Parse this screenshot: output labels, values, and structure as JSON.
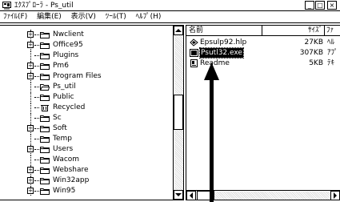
{
  "window": {
    "title": "ｴｸｽﾌﾟﾛｰﾗ - Ps_util",
    "minimize_label": "_",
    "maximize_label": "□",
    "close_label": "×"
  },
  "menubar": {
    "items": [
      {
        "label": "ﾌｧｲﾙ(F)"
      },
      {
        "label": "編集(E)"
      },
      {
        "label": "表示(V)"
      },
      {
        "label": "ﾂｰﾙ(T)"
      },
      {
        "label": "ﾍﾙﾌﾟ(H)"
      }
    ]
  },
  "tree": {
    "items": [
      {
        "label": "Nwclient",
        "expandable": true,
        "expander": "+"
      },
      {
        "label": "Office95",
        "expandable": true,
        "expander": "+"
      },
      {
        "label": "Plugins",
        "expandable": false,
        "expander": ""
      },
      {
        "label": "Pm6",
        "expandable": true,
        "expander": "+"
      },
      {
        "label": "Program Files",
        "expandable": true,
        "expander": "+"
      },
      {
        "label": "Ps_util",
        "expandable": false,
        "expander": "",
        "open": true
      },
      {
        "label": "Public",
        "expandable": false,
        "expander": ""
      },
      {
        "label": "Recycled",
        "expandable": false,
        "expander": "",
        "icon": "recycle-bin"
      },
      {
        "label": "Sc",
        "expandable": false,
        "expander": ""
      },
      {
        "label": "Soft",
        "expandable": true,
        "expander": "+"
      },
      {
        "label": "Temp",
        "expandable": false,
        "expander": ""
      },
      {
        "label": "Users",
        "expandable": true,
        "expander": "+"
      },
      {
        "label": "Wacom",
        "expandable": false,
        "expander": ""
      },
      {
        "label": "Webshare",
        "expandable": true,
        "expander": "+"
      },
      {
        "label": "Win32app",
        "expandable": true,
        "expander": "+"
      },
      {
        "label": "Win95",
        "expandable": true,
        "expander": "+"
      }
    ]
  },
  "list": {
    "columns": [
      {
        "label": "名前"
      },
      {
        "label": "ｻｲｽﾞ"
      },
      {
        "label": "ﾌｧ"
      }
    ],
    "files": [
      {
        "name": "Epsulp92.hlp",
        "size": "27KB",
        "type": "ﾍﾙ",
        "icon": "help-file-icon",
        "selected": false
      },
      {
        "name": "Psutl32.exe",
        "size": "307KB",
        "type": "ｱﾌﾟ",
        "icon": "application-icon",
        "selected": true
      },
      {
        "name": "Readme",
        "size": "5KB",
        "type": "ﾃｷ",
        "icon": "text-file-icon",
        "selected": false
      }
    ]
  },
  "colors": {
    "selection": "#000000",
    "background": "#ffffff",
    "border": "#000000"
  }
}
